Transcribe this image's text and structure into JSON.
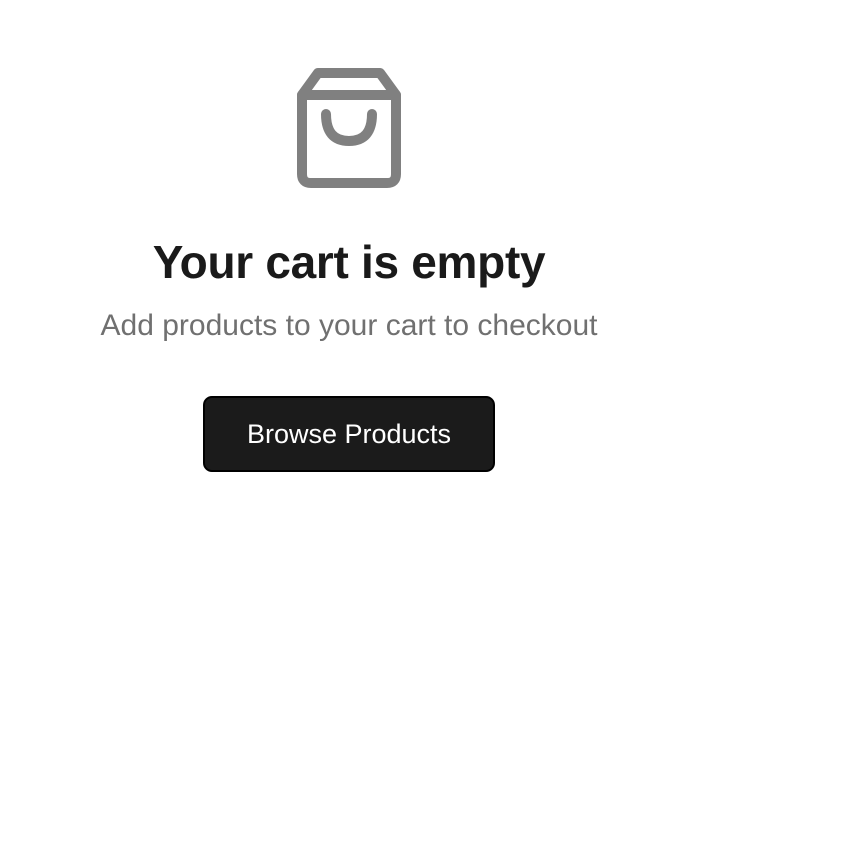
{
  "empty_cart": {
    "icon": "shopping-bag-icon",
    "icon_color": "#808080",
    "title": "Your cart is empty",
    "subtitle": "Add products to your cart to checkout",
    "button_label": "Browse Products",
    "button_color": "#1b1b1b"
  }
}
